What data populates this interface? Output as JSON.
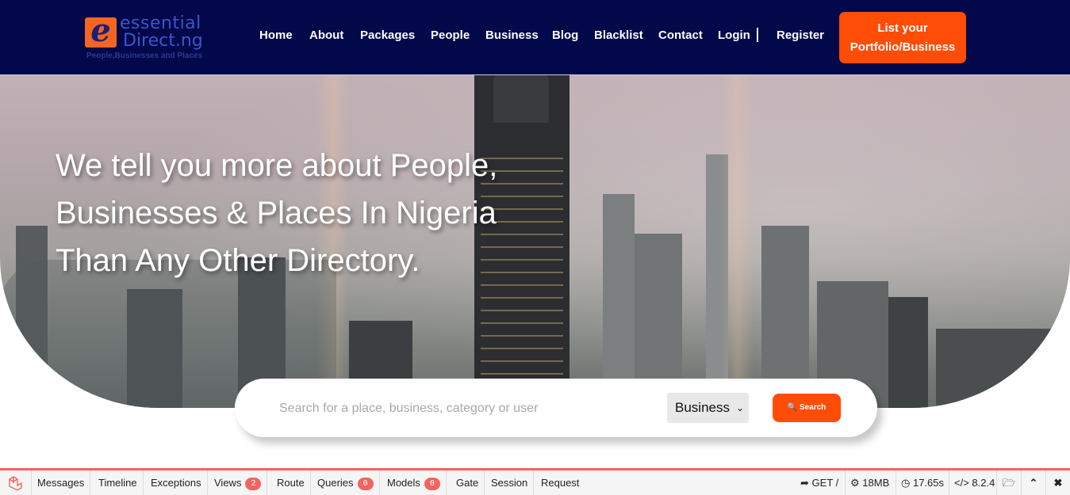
{
  "logo": {
    "line1": "essential",
    "line2": "Direct.ng",
    "letter": "e",
    "tagline": "People,Businesses and Places"
  },
  "nav": {
    "items": [
      "Home",
      "About",
      "Packages",
      "People",
      "Business",
      "Blog",
      "Blacklist",
      "Contact",
      "Login",
      "Register"
    ],
    "cta": "List your Portfolio/Business"
  },
  "hero": {
    "headline": "We tell you more about People, Businesses & Places In Nigeria Than Any Other Directory."
  },
  "search": {
    "placeholder": "Search for a place, business, category or user",
    "type_selected": "Business",
    "button": "Search"
  },
  "debugbar": {
    "tabs": [
      {
        "label": "Messages"
      },
      {
        "label": "Timeline"
      },
      {
        "label": "Exceptions"
      },
      {
        "label": "Views",
        "count": "2"
      },
      {
        "label": "Route"
      },
      {
        "label": "Queries",
        "count": "0"
      },
      {
        "label": "Models",
        "count": "0"
      },
      {
        "label": "Gate"
      },
      {
        "label": "Session"
      },
      {
        "label": "Request"
      }
    ],
    "method": "GET /",
    "memory": "18MB",
    "time": "17.65s",
    "php": "8.2.4"
  },
  "colors": {
    "nav_bg": "#020849",
    "accent": "#ff4c06",
    "debug_accent": "#f4645f"
  },
  "icons": [
    "laravel-icon",
    "share-icon",
    "cogs-icon",
    "clock-icon",
    "code-icon",
    "folder-icon",
    "chevron-up-icon",
    "close-icon",
    "search-icon",
    "chevron-down-icon"
  ]
}
